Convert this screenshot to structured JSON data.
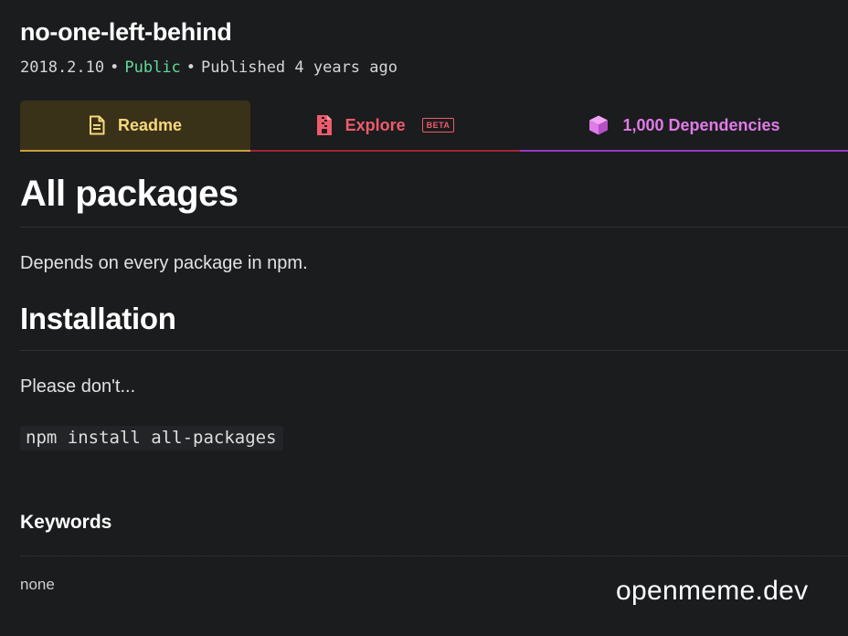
{
  "package": {
    "name": "no-one-left-behind",
    "version": "2018.2.10",
    "visibility": "Public",
    "published": "Published 4 years ago"
  },
  "tabs": [
    {
      "label": "Readme",
      "icon": "document-icon",
      "color": "#f7d87c",
      "active": true
    },
    {
      "label": "Explore",
      "icon": "zip-file-icon",
      "color": "#ee5b6d",
      "badge": "BETA"
    },
    {
      "label": "1,000 Dependencies",
      "icon": "cube-icon",
      "color": "#e07be8"
    }
  ],
  "readme": {
    "title": "All packages",
    "description": "Depends on every package in npm.",
    "installation_heading": "Installation",
    "installation_note": "Please don't...",
    "install_command": "npm install all-packages"
  },
  "keywords": {
    "heading": "Keywords",
    "value": "none"
  },
  "watermark": "openmeme.dev",
  "colors": {
    "background": "#1b1c1e",
    "public": "#62d99a",
    "readme_tab_bg": "#3a3119"
  }
}
